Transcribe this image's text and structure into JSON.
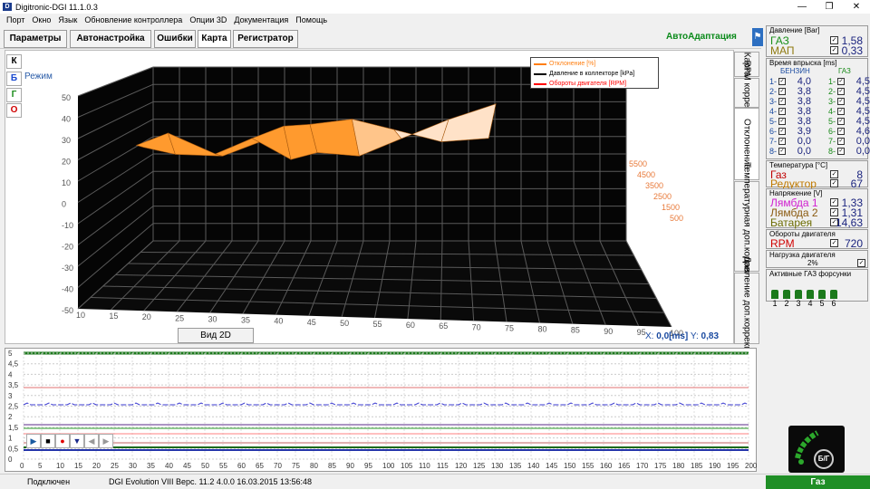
{
  "window": {
    "title": "Digitronic-DGI  11.1.0.3",
    "icon": "app-logo-icon",
    "controls": [
      "minimize-icon",
      "maximize-icon",
      "close-icon"
    ]
  },
  "menu": [
    "Порт",
    "Окно",
    "Язык",
    "Обновление контроллера",
    "Опции 3D",
    "Документация",
    "Помощь"
  ],
  "tabs": [
    "Параметры",
    "Автонастройка",
    "Ошибки",
    "Карта",
    "Регистратор"
  ],
  "auto_adapt": "АвтоАдаптация",
  "side_buttons": [
    "К",
    "Б",
    "Г",
    "О"
  ],
  "mode_label": "Режим",
  "legend": [
    {
      "label": "Отклонение [%]",
      "color": "#ff7f11"
    },
    {
      "label": "Давление в коллекторе [kPa]",
      "color": "#000000"
    },
    {
      "label": "Обороты двигателя [RPM]",
      "color": "#ff0000"
    }
  ],
  "view2d": "Вид 2D",
  "xy": {
    "x_label": "X:",
    "x_value": "0,0[ms]",
    "y_label": "Y:",
    "y_value": "0,83"
  },
  "vtabs": [
    "Карта",
    "RPM коррекция",
    "Отклонение",
    "Температурная доп.коррекция",
    "Давление доп.коррекция"
  ],
  "sidebar": {
    "pressure": {
      "title": "Давление [Bar]",
      "rows": [
        {
          "label": "ГАЗ",
          "color": "#1a8f1a",
          "value": "1,58"
        },
        {
          "label": "МАП",
          "color": "#8f7a10",
          "value": "0,33"
        }
      ]
    },
    "inj": {
      "title": "Время впрыска [ms]",
      "col_benzin": "БЕНЗИН",
      "col_gaz": "ГАЗ",
      "benzin": [
        {
          "n": "1-",
          "v": "4,0"
        },
        {
          "n": "2-",
          "v": "3,8"
        },
        {
          "n": "3-",
          "v": "3,8"
        },
        {
          "n": "4-",
          "v": "3,8"
        },
        {
          "n": "5-",
          "v": "3,8"
        },
        {
          "n": "6-",
          "v": "3,9"
        },
        {
          "n": "7-",
          "v": "0,0"
        },
        {
          "n": "8-",
          "v": "0,0"
        }
      ],
      "gaz": [
        {
          "n": "1-",
          "v": "4,5"
        },
        {
          "n": "2-",
          "v": "4,5"
        },
        {
          "n": "3-",
          "v": "4,5"
        },
        {
          "n": "4-",
          "v": "4,5"
        },
        {
          "n": "5-",
          "v": "4,5"
        },
        {
          "n": "6-",
          "v": "4,6"
        },
        {
          "n": "7-",
          "v": "0,0"
        },
        {
          "n": "8-",
          "v": "0,0"
        }
      ]
    },
    "temp": {
      "title": "Температура  [°C]",
      "rows": [
        {
          "label": "Газ",
          "color": "#c00000",
          "value": "8"
        },
        {
          "label": "Редуктор",
          "color": "#c07a00",
          "value": "67"
        }
      ]
    },
    "volt": {
      "title": "Напряжение [V]",
      "rows": [
        {
          "label": "Лямбда 1",
          "color": "#d020d0",
          "value": "1,33"
        },
        {
          "label": "Лямбда 2",
          "color": "#8a5a10",
          "value": "1,31"
        },
        {
          "label": "Батарея",
          "color": "#6b6b00",
          "value": "14,63"
        }
      ]
    },
    "rpm": {
      "title": "Обороты двигателя",
      "label": "RPM",
      "color": "#d00000",
      "value": "720"
    },
    "load": {
      "title": "Нагрузка двигателя",
      "value": "2%"
    },
    "nozzles": {
      "title": "Активные ГАЗ форсунки",
      "items": [
        "1",
        "2",
        "3",
        "4",
        "5",
        "6"
      ]
    }
  },
  "osc": {
    "buttons": [
      "play-icon",
      "stop-icon",
      "record-icon",
      "download-icon",
      "prev-icon",
      "next-icon"
    ],
    "y_ticks": [
      "5",
      "4,5",
      "4",
      "3,5",
      "3",
      "2,5",
      "2",
      "1,5",
      "1",
      "0,5",
      "0"
    ],
    "x_ticks": [
      "0",
      "5",
      "10",
      "15",
      "20",
      "25",
      "30",
      "35",
      "40",
      "45",
      "50",
      "55",
      "60",
      "65",
      "70",
      "75",
      "80",
      "85",
      "90",
      "95",
      "100",
      "105",
      "110",
      "115",
      "120",
      "125",
      "130",
      "135",
      "140",
      "145",
      "150",
      "155",
      "160",
      "165",
      "170",
      "175",
      "180",
      "185",
      "190",
      "195",
      "200"
    ]
  },
  "status": {
    "conn": "Подключен",
    "info": "DGI Evolution VIII   Верс.  11.2  4.0.0     16.03.2015 13:56:48",
    "gas": "Газ"
  },
  "dash_btn": "Б/Г",
  "chart_data": {
    "type": "area",
    "title": "",
    "y_ticks": [
      50,
      40,
      30,
      20,
      10,
      0,
      -10,
      -20,
      -30,
      -40,
      -50
    ],
    "x_ticks": [
      10,
      15,
      20,
      25,
      30,
      35,
      40,
      45,
      50,
      55,
      60,
      65,
      70,
      75,
      80,
      85,
      90,
      95,
      100
    ],
    "z_ticks": [
      5500,
      4500,
      3500,
      2500,
      1500,
      500
    ],
    "series": [
      {
        "x": [
          12,
          18,
          27,
          34,
          40,
          45,
          53,
          61,
          70,
          79
        ],
        "values": [
          5,
          12,
          0,
          9,
          16,
          17,
          20,
          14,
          7,
          9
        ]
      },
      {
        "x": [
          12,
          18,
          27,
          34,
          40,
          45,
          53,
          61,
          70,
          79
        ],
        "values": [
          9,
          5,
          4,
          12,
          2,
          6,
          4,
          14,
          25,
          34
        ]
      }
    ]
  }
}
